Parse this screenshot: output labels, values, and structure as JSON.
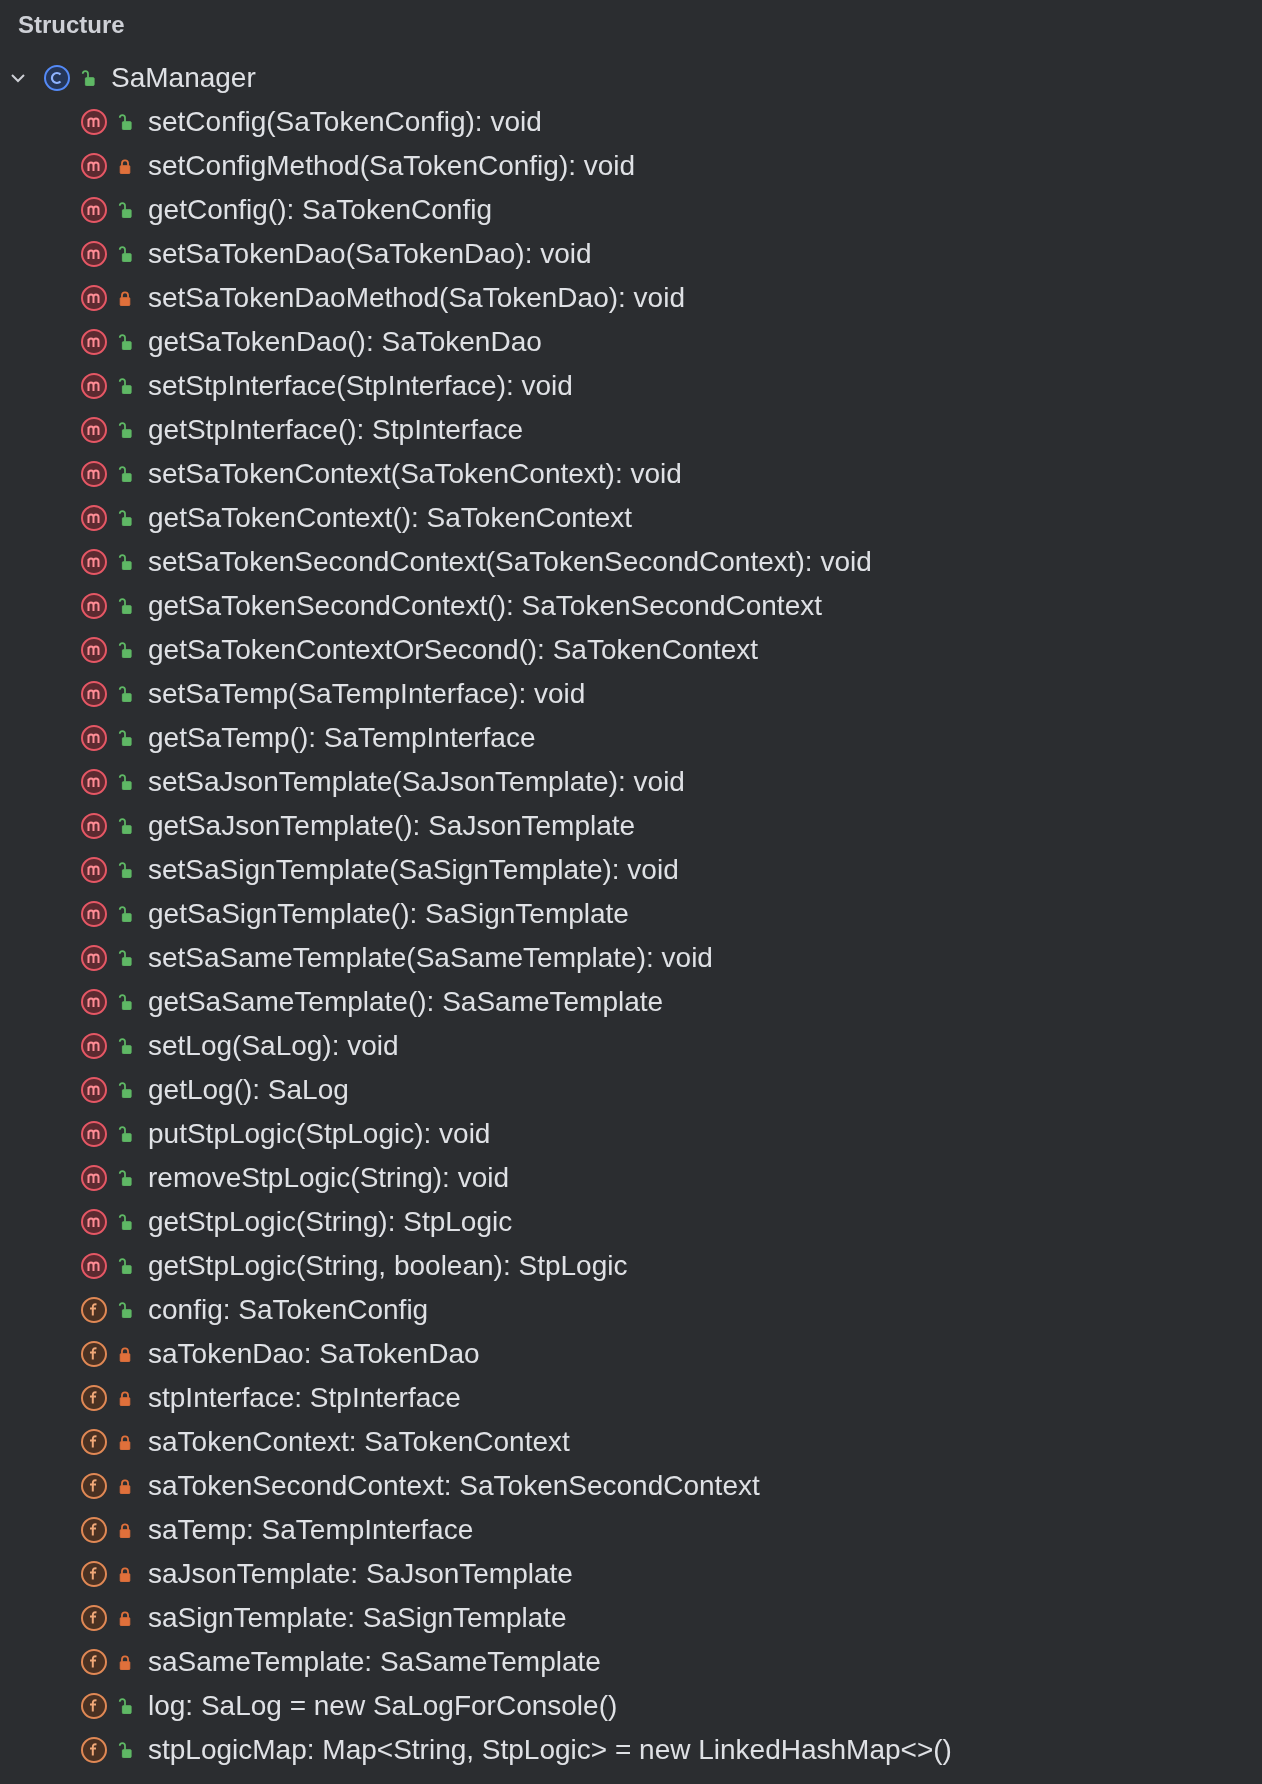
{
  "panel": {
    "title": "Structure"
  },
  "tree": {
    "label": "SaManager",
    "kind": "class",
    "locked": false,
    "expanded": true,
    "children": [
      {
        "label": "setConfig(SaTokenConfig): void",
        "kind": "method",
        "locked": false
      },
      {
        "label": "setConfigMethod(SaTokenConfig): void",
        "kind": "method",
        "locked": true
      },
      {
        "label": "getConfig(): SaTokenConfig",
        "kind": "method",
        "locked": false
      },
      {
        "label": "setSaTokenDao(SaTokenDao): void",
        "kind": "method",
        "locked": false
      },
      {
        "label": "setSaTokenDaoMethod(SaTokenDao): void",
        "kind": "method",
        "locked": true
      },
      {
        "label": "getSaTokenDao(): SaTokenDao",
        "kind": "method",
        "locked": false
      },
      {
        "label": "setStpInterface(StpInterface): void",
        "kind": "method",
        "locked": false
      },
      {
        "label": "getStpInterface(): StpInterface",
        "kind": "method",
        "locked": false
      },
      {
        "label": "setSaTokenContext(SaTokenContext): void",
        "kind": "method",
        "locked": false
      },
      {
        "label": "getSaTokenContext(): SaTokenContext",
        "kind": "method",
        "locked": false
      },
      {
        "label": "setSaTokenSecondContext(SaTokenSecondContext): void",
        "kind": "method",
        "locked": false
      },
      {
        "label": "getSaTokenSecondContext(): SaTokenSecondContext",
        "kind": "method",
        "locked": false
      },
      {
        "label": "getSaTokenContextOrSecond(): SaTokenContext",
        "kind": "method",
        "locked": false
      },
      {
        "label": "setSaTemp(SaTempInterface): void",
        "kind": "method",
        "locked": false
      },
      {
        "label": "getSaTemp(): SaTempInterface",
        "kind": "method",
        "locked": false
      },
      {
        "label": "setSaJsonTemplate(SaJsonTemplate): void",
        "kind": "method",
        "locked": false
      },
      {
        "label": "getSaJsonTemplate(): SaJsonTemplate",
        "kind": "method",
        "locked": false
      },
      {
        "label": "setSaSignTemplate(SaSignTemplate): void",
        "kind": "method",
        "locked": false
      },
      {
        "label": "getSaSignTemplate(): SaSignTemplate",
        "kind": "method",
        "locked": false
      },
      {
        "label": "setSaSameTemplate(SaSameTemplate): void",
        "kind": "method",
        "locked": false
      },
      {
        "label": "getSaSameTemplate(): SaSameTemplate",
        "kind": "method",
        "locked": false
      },
      {
        "label": "setLog(SaLog): void",
        "kind": "method",
        "locked": false
      },
      {
        "label": "getLog(): SaLog",
        "kind": "method",
        "locked": false
      },
      {
        "label": "putStpLogic(StpLogic): void",
        "kind": "method",
        "locked": false
      },
      {
        "label": "removeStpLogic(String): void",
        "kind": "method",
        "locked": false
      },
      {
        "label": "getStpLogic(String): StpLogic",
        "kind": "method",
        "locked": false
      },
      {
        "label": "getStpLogic(String, boolean): StpLogic",
        "kind": "method",
        "locked": false
      },
      {
        "label": "config: SaTokenConfig",
        "kind": "field",
        "locked": false
      },
      {
        "label": "saTokenDao: SaTokenDao",
        "kind": "field",
        "locked": true
      },
      {
        "label": "stpInterface: StpInterface",
        "kind": "field",
        "locked": true
      },
      {
        "label": "saTokenContext: SaTokenContext",
        "kind": "field",
        "locked": true
      },
      {
        "label": "saTokenSecondContext: SaTokenSecondContext",
        "kind": "field",
        "locked": true
      },
      {
        "label": "saTemp: SaTempInterface",
        "kind": "field",
        "locked": true
      },
      {
        "label": "saJsonTemplate: SaJsonTemplate",
        "kind": "field",
        "locked": true
      },
      {
        "label": "saSignTemplate: SaSignTemplate",
        "kind": "field",
        "locked": true
      },
      {
        "label": "saSameTemplate: SaSameTemplate",
        "kind": "field",
        "locked": true
      },
      {
        "label": "log: SaLog = new SaLogForConsole()",
        "kind": "field",
        "locked": false
      },
      {
        "label": "stpLogicMap: Map<String, StpLogic> = new LinkedHashMap<>()",
        "kind": "field",
        "locked": false
      }
    ]
  }
}
